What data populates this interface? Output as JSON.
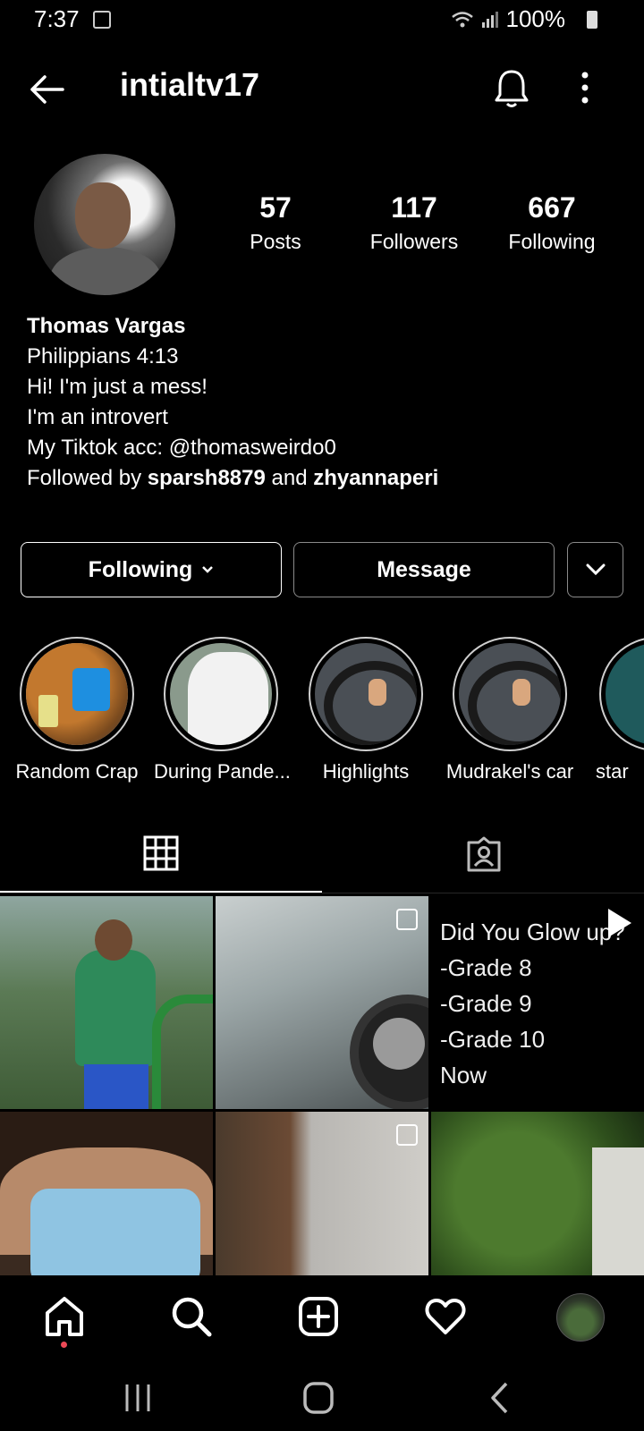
{
  "status_bar": {
    "time": "7:37",
    "battery": "100%"
  },
  "header": {
    "username": "intialtv17"
  },
  "profile": {
    "stats": [
      {
        "value": "57",
        "label": "Posts"
      },
      {
        "value": "117",
        "label": "Followers"
      },
      {
        "value": "667",
        "label": "Following"
      }
    ],
    "name": "Thomas Vargas",
    "bio_lines": [
      "Philippians 4:13",
      "Hi! I'm just a mess!",
      "I'm an introvert",
      "My Tiktok acc: @thomasweirdo0"
    ],
    "followed_by": {
      "prefix": "Followed by",
      "user1": "sparsh8879",
      "joiner": "and",
      "user2": "zhyannaperi"
    }
  },
  "actions": {
    "following": "Following",
    "message": "Message"
  },
  "highlights": [
    {
      "label": "Random Crap"
    },
    {
      "label": "During Pande..."
    },
    {
      "label": "Highlights"
    },
    {
      "label": "Mudrakel's car"
    },
    {
      "label": "star"
    }
  ],
  "posts": {
    "caption": [
      "Did You Glow up?",
      "-Grade 8",
      "-Grade 9",
      "-Grade 10",
      "Now"
    ]
  },
  "icons": [
    "back-arrow-icon",
    "bell-icon",
    "more-vertical-icon",
    "grid-icon",
    "tagged-icon",
    "home-icon",
    "search-icon",
    "add-post-icon",
    "heart-icon"
  ],
  "colors": {
    "background": "#000000",
    "text": "#ffffff",
    "notification_dot": "#ed4956"
  }
}
